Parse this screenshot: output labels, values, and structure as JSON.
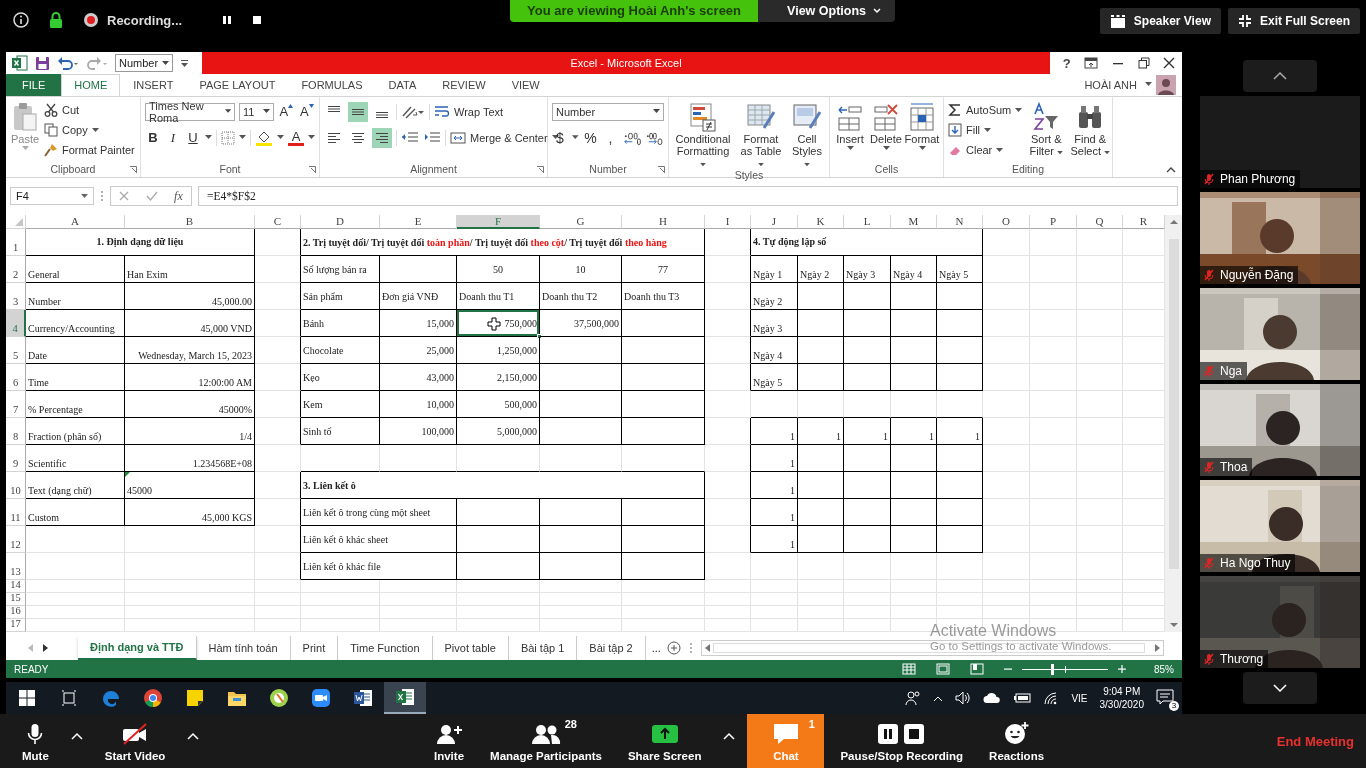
{
  "zoom_top": {
    "recording": "Recording...",
    "banner": "You are viewing Hoài Anh's screen",
    "view_options": "View Options",
    "speaker_view": "Speaker View",
    "exit_full_screen": "Exit Full Screen"
  },
  "excel": {
    "quick_format": "Number",
    "title": "Excel -  Microsoft Excel",
    "help": "?",
    "tabs": [
      {
        "label": "FILE",
        "kind": "file",
        "selected": false
      },
      {
        "label": "HOME",
        "kind": "tab",
        "selected": true
      },
      {
        "label": "INSERT",
        "kind": "tab",
        "selected": false
      },
      {
        "label": "PAGE LAYOUT",
        "kind": "tab",
        "selected": false
      },
      {
        "label": "FORMULAS",
        "kind": "tab",
        "selected": false
      },
      {
        "label": "DATA",
        "kind": "tab",
        "selected": false
      },
      {
        "label": "REVIEW",
        "kind": "tab",
        "selected": false
      },
      {
        "label": "VIEW",
        "kind": "tab",
        "selected": false
      }
    ],
    "user": "HOÀI ANH",
    "ribbon": {
      "clipboard": {
        "label": "Clipboard",
        "paste": "Paste",
        "cut": "Cut",
        "copy": "Copy",
        "format_painter": "Format Painter"
      },
      "font": {
        "label": "Font",
        "name": "Times New Roma",
        "size": "11",
        "grow": "A",
        "shrink": "A",
        "bold": "B",
        "italic": "I",
        "underline": "U",
        "font_color_letter": "A"
      },
      "alignment": {
        "label": "Alignment",
        "wrap": "Wrap Text",
        "merge": "Merge & Center",
        "vertical": [
          {
            "selected": false
          },
          {
            "selected": true
          },
          {
            "selected": false
          }
        ],
        "horizontal": [
          {
            "selected": false
          },
          {
            "selected": false
          },
          {
            "selected": true
          }
        ]
      },
      "number": {
        "label": "Number",
        "format": "Number",
        "currency": "$",
        "percent": "%",
        "comma": ","
      },
      "styles": {
        "label": "Styles",
        "items": [
          "Conditional Formatting",
          "Format as Table",
          "Cell Styles"
        ]
      },
      "cells": {
        "label": "Cells",
        "items": [
          "Insert",
          "Delete",
          "Format"
        ]
      },
      "editing": {
        "label": "Editing",
        "autosum": "AutoSum",
        "fill": "Fill",
        "clear": "Clear",
        "sort": "Sort & Filter",
        "find": "Find & Select"
      }
    },
    "formula_bar": {
      "name_box": "F4",
      "fx": "fx",
      "formula": "=E4*$F$2"
    },
    "columns": [
      {
        "label": "A",
        "selected": false
      },
      {
        "label": "B",
        "selected": false
      },
      {
        "label": "C",
        "selected": false
      },
      {
        "label": "D",
        "selected": false
      },
      {
        "label": "E",
        "selected": false
      },
      {
        "label": "F",
        "selected": true
      },
      {
        "label": "G",
        "selected": false
      },
      {
        "label": "H",
        "selected": false
      },
      {
        "label": "I",
        "selected": false
      },
      {
        "label": "J",
        "selected": false
      },
      {
        "label": "K",
        "selected": false
      },
      {
        "label": "L",
        "selected": false
      },
      {
        "label": "M",
        "selected": false
      },
      {
        "label": "N",
        "selected": false
      },
      {
        "label": "O",
        "selected": false
      },
      {
        "label": "P",
        "selected": false
      },
      {
        "label": "Q",
        "selected": false
      },
      {
        "label": "R",
        "selected": false
      }
    ],
    "rows": [
      {
        "label": "1",
        "selected": false,
        "cells": [
          {
            "text": "1. Định dạng dữ liệu",
            "kind": "title",
            "bordered": true
          },
          {
            "kind": "merged"
          },
          {
            "bordered": false
          },
          {
            "kind": "rich",
            "bordered": true,
            "segments": [
              {
                "text": "2. Trị tuyệt đối/ Trị tuyệt đối ",
                "highlight": false
              },
              {
                "text": "toàn phần",
                "highlight": true
              },
              {
                "text": "/ Trị tuyệt đối ",
                "highlight": false
              },
              {
                "text": "theo cột",
                "highlight": true
              },
              {
                "text": "/ Trị tuyệt đối ",
                "highlight": false
              },
              {
                "text": "theo hàng",
                "highlight": true
              }
            ]
          },
          {
            "kind": "merged"
          },
          {
            "kind": "merged"
          },
          {
            "kind": "merged"
          },
          {
            "kind": "merged"
          },
          {
            "bordered": false
          },
          {
            "text": "4. Tự động lập số",
            "kind": "heading",
            "bordered": true
          },
          {
            "kind": "merged"
          },
          {
            "kind": "merged"
          },
          {
            "kind": "merged"
          },
          {
            "kind": "merged"
          }
        ]
      },
      {
        "label": "2",
        "selected": false,
        "cells": [
          {
            "text": "General",
            "kind": "text",
            "bordered": true
          },
          {
            "text": "Han Exim",
            "kind": "text",
            "bordered": true
          },
          {
            "bordered": false
          },
          {
            "text": "Số lượng bán ra",
            "kind": "text",
            "bordered": true
          },
          {
            "bordered": true
          },
          {
            "text": "50",
            "kind": "centered",
            "bordered": true
          },
          {
            "text": "10",
            "kind": "centered",
            "bordered": true
          },
          {
            "text": "77",
            "kind": "centered",
            "bordered": true
          },
          {
            "bordered": false
          },
          {
            "text": "Ngày 1",
            "kind": "text",
            "bordered": true
          },
          {
            "text": "Ngày 2",
            "kind": "text",
            "bordered": true
          },
          {
            "text": "Ngày 3",
            "kind": "text",
            "bordered": true
          },
          {
            "text": "Ngày 4",
            "kind": "text",
            "bordered": true
          },
          {
            "text": "Ngày 5",
            "kind": "text",
            "bordered": true
          }
        ]
      },
      {
        "label": "3",
        "selected": false,
        "cells": [
          {
            "text": "Number",
            "kind": "text",
            "bordered": true
          },
          {
            "text": "45,000.00",
            "kind": "number",
            "bordered": true
          },
          {
            "bordered": false
          },
          {
            "text": "Sản phẩm",
            "kind": "text",
            "bordered": true
          },
          {
            "text": "Đơn giá VNĐ",
            "kind": "text",
            "bordered": true
          },
          {
            "text": "Doanh thu T1",
            "kind": "text",
            "bordered": true
          },
          {
            "text": "Doanh thu T2",
            "kind": "text",
            "bordered": true
          },
          {
            "text": "Doanh thu T3",
            "kind": "text",
            "bordered": true
          },
          {
            "bordered": false
          },
          {
            "text": "Ngày 2",
            "kind": "text",
            "bordered": true
          },
          {
            "bordered": true
          },
          {
            "bordered": true
          },
          {
            "bordered": true
          },
          {
            "bordered": true
          }
        ]
      },
      {
        "label": "4",
        "selected": true,
        "cells": [
          {
            "text": "Currency/Accounting",
            "kind": "text",
            "bordered": true
          },
          {
            "text": "45,000 VND",
            "kind": "number",
            "bordered": true
          },
          {
            "bordered": false
          },
          {
            "text": "Bánh",
            "kind": "text",
            "bordered": true
          },
          {
            "text": "15,000",
            "kind": "number",
            "bordered": true
          },
          {
            "text": "750,000",
            "kind": "number",
            "bordered": true
          },
          {
            "text": "37,500,000",
            "kind": "number",
            "bordered": true
          },
          {
            "bordered": true
          },
          {
            "bordered": false
          },
          {
            "text": "Ngày 3",
            "kind": "text",
            "bordered": true
          },
          {
            "bordered": true
          },
          {
            "bordered": true
          },
          {
            "bordered": true
          },
          {
            "bordered": true
          }
        ]
      },
      {
        "label": "5",
        "selected": false,
        "cells": [
          {
            "text": "Date",
            "kind": "text",
            "bordered": true
          },
          {
            "text": "Wednesday, March 15, 2023",
            "kind": "number",
            "bordered": true
          },
          {
            "bordered": false
          },
          {
            "text": "Chocolate",
            "kind": "text",
            "bordered": true
          },
          {
            "text": "25,000",
            "kind": "number",
            "bordered": true
          },
          {
            "text": "1,250,000",
            "kind": "number",
            "bordered": true
          },
          {
            "bordered": true
          },
          {
            "bordered": true
          },
          {
            "bordered": false
          },
          {
            "text": "Ngày 4",
            "kind": "text",
            "bordered": true
          },
          {
            "bordered": true
          },
          {
            "bordered": true
          },
          {
            "bordered": true
          },
          {
            "bordered": true
          }
        ]
      },
      {
        "label": "6",
        "selected": false,
        "cells": [
          {
            "text": "Time",
            "kind": "text",
            "bordered": true
          },
          {
            "text": "12:00:00 AM",
            "kind": "number",
            "bordered": true
          },
          {
            "bordered": false
          },
          {
            "text": "Kẹo",
            "kind": "text",
            "bordered": true
          },
          {
            "text": "43,000",
            "kind": "number",
            "bordered": true
          },
          {
            "text": "2,150,000",
            "kind": "number",
            "bordered": true
          },
          {
            "bordered": true
          },
          {
            "bordered": true
          },
          {
            "bordered": false
          },
          {
            "text": "Ngày 5",
            "kind": "text",
            "bordered": true
          },
          {
            "bordered": true
          },
          {
            "bordered": true
          },
          {
            "bordered": true
          },
          {
            "bordered": true
          }
        ]
      },
      {
        "label": "7",
        "selected": false,
        "cells": [
          {
            "text": "% Percentage",
            "kind": "text",
            "bordered": true
          },
          {
            "text": "45000%",
            "kind": "number",
            "bordered": true
          },
          {
            "bordered": false
          },
          {
            "text": "Kem",
            "kind": "text",
            "bordered": true
          },
          {
            "text": "10,000",
            "kind": "number",
            "bordered": true
          },
          {
            "text": "500,000",
            "kind": "number",
            "bordered": true
          },
          {
            "bordered": true
          },
          {
            "bordered": true
          }
        ]
      },
      {
        "label": "8",
        "selected": false,
        "cells": [
          {
            "text": "Fraction (phân số)",
            "kind": "text",
            "bordered": true
          },
          {
            "text": "1/4",
            "kind": "number",
            "bordered": true
          },
          {
            "bordered": false
          },
          {
            "text": "Sinh tố",
            "kind": "text",
            "bordered": true
          },
          {
            "text": "100,000",
            "kind": "number",
            "bordered": true
          },
          {
            "text": "5,000,000",
            "kind": "number",
            "bordered": true
          },
          {
            "bordered": true
          },
          {
            "bordered": true
          },
          {
            "bordered": false
          },
          {
            "text": "1",
            "kind": "number",
            "bordered": true
          },
          {
            "text": "1",
            "kind": "number",
            "bordered": true
          },
          {
            "text": "1",
            "kind": "number",
            "bordered": true
          },
          {
            "text": "1",
            "kind": "number",
            "bordered": true
          },
          {
            "text": "1",
            "kind": "number",
            "bordered": true
          }
        ]
      },
      {
        "label": "9",
        "selected": false,
        "cells": [
          {
            "text": "Scientific",
            "kind": "text",
            "bordered": true
          },
          {
            "text": "1.234568E+08",
            "kind": "number",
            "bordered": true
          },
          {
            "bordered": false
          },
          {
            "bordered": false
          },
          {
            "bordered": false
          },
          {
            "bordered": false
          },
          {
            "bordered": false
          },
          {
            "bordered": false
          },
          {
            "bordered": false
          },
          {
            "text": "1",
            "kind": "number",
            "bordered": true
          },
          {
            "bordered": true
          },
          {
            "bordered": true
          },
          {
            "bordered": true
          },
          {
            "bordered": true
          }
        ]
      },
      {
        "label": "10",
        "selected": false,
        "cells": [
          {
            "text": "Text (dạng chữ)",
            "kind": "text",
            "bordered": true
          },
          {
            "text": "45000",
            "kind": "text",
            "bordered": true,
            "flagged": true
          },
          {
            "bordered": false
          },
          {
            "text": "3. Liên kết ô",
            "kind": "heading",
            "bordered": true
          },
          {
            "kind": "merged"
          },
          {
            "kind": "merged"
          },
          {
            "kind": "merged"
          },
          {
            "kind": "merged"
          },
          {
            "bordered": false
          },
          {
            "text": "1",
            "kind": "number",
            "bordered": true
          },
          {
            "bordered": true
          },
          {
            "bordered": true
          },
          {
            "bordered": true
          },
          {
            "bordered": true
          }
        ]
      },
      {
        "label": "11",
        "selected": false,
        "cells": [
          {
            "text": "Custom",
            "kind": "text",
            "bordered": true
          },
          {
            "text": "45,000 KGS",
            "kind": "number",
            "bordered": true
          },
          {
            "bordered": false
          },
          {
            "text": "Liên kết ô trong cùng một sheet",
            "kind": "text",
            "bordered": true
          },
          {
            "kind": "merged"
          },
          {
            "bordered": true
          },
          {
            "bordered": true
          },
          {
            "bordered": true
          },
          {
            "bordered": false
          },
          {
            "text": "1",
            "kind": "number",
            "bordered": true
          },
          {
            "bordered": true
          },
          {
            "bordered": true
          },
          {
            "bordered": true
          },
          {
            "bordered": true
          }
        ]
      },
      {
        "label": "12",
        "selected": false,
        "cells": [
          {
            "bordered": false
          },
          {
            "bordered": false
          },
          {
            "bordered": false
          },
          {
            "text": "Liên kết ô khác sheet",
            "kind": "text",
            "bordered": true
          },
          {
            "kind": "merged"
          },
          {
            "bordered": true
          },
          {
            "bordered": true
          },
          {
            "bordered": true
          },
          {
            "bordered": false
          },
          {
            "text": "1",
            "kind": "number",
            "bordered": true
          },
          {
            "bordered": true
          },
          {
            "bordered": true
          },
          {
            "bordered": true
          },
          {
            "bordered": true
          }
        ]
      },
      {
        "label": "13",
        "selected": false,
        "cells": [
          {
            "bordered": false
          },
          {
            "bordered": false
          },
          {
            "bordered": false
          },
          {
            "text": "Liên kết ô khác file",
            "kind": "text",
            "bordered": true
          },
          {
            "kind": "merged"
          },
          {
            "bordered": true
          },
          {
            "bordered": true
          },
          {
            "bordered": true
          }
        ]
      },
      {
        "label": "14",
        "selected": false
      },
      {
        "label": "15",
        "selected": false
      },
      {
        "label": "16",
        "selected": false
      },
      {
        "label": "17",
        "selected": false
      }
    ],
    "sheet_tabs": [
      {
        "label": "Định dạng và TTĐ",
        "selected": true
      },
      {
        "label": "Hàm tính toán",
        "selected": false
      },
      {
        "label": "Print",
        "selected": false
      },
      {
        "label": "Time Function",
        "selected": false
      },
      {
        "label": "Pivot table",
        "selected": false
      },
      {
        "label": "Bài tập 1",
        "selected": false
      },
      {
        "label": "Bài tập 2",
        "selected": false
      }
    ],
    "more_tabs": "...",
    "status": "READY",
    "zoom": {
      "level": 0.35,
      "reading": "85%"
    }
  },
  "activation_notice": {
    "title": "Activate Windows",
    "detail": "Go to Settings to activate Windows."
  },
  "taskbar": {
    "apps": [
      {
        "kind": "start",
        "selected": false
      },
      {
        "kind": "task-view",
        "selected": false
      },
      {
        "kind": "edge",
        "selected": false
      },
      {
        "kind": "chrome",
        "selected": false
      },
      {
        "kind": "sticky",
        "selected": false
      },
      {
        "kind": "explorer",
        "selected": false
      },
      {
        "kind": "green-app",
        "selected": false
      },
      {
        "kind": "zoom",
        "selected": false
      },
      {
        "kind": "word",
        "selected": false
      },
      {
        "kind": "excel",
        "selected": true
      }
    ],
    "language": "VIE",
    "time": "9:04 PM",
    "date": "3/30/2020",
    "notifications": "3"
  },
  "participants": [
    {
      "name": "Phan Phương",
      "muted": true,
      "video": false
    },
    {
      "name": "Nguyễn Đặng",
      "muted": true,
      "video": true
    },
    {
      "name": "Nga",
      "muted": true,
      "video": true
    },
    {
      "name": "Thoa",
      "muted": true,
      "video": true
    },
    {
      "name": "Ha Ngo Thuy",
      "muted": true,
      "video": true
    },
    {
      "name": "Thương",
      "muted": true,
      "video": true
    }
  ],
  "toolbar": {
    "items": [
      {
        "kind": "mute",
        "label": "Mute"
      },
      {
        "kind": "caret"
      },
      {
        "kind": "video-off",
        "label": "Start Video"
      },
      {
        "kind": "caret"
      },
      {
        "kind": "invite",
        "label": "Invite"
      },
      {
        "kind": "participants",
        "label": "Manage Participants",
        "count": "28"
      },
      {
        "kind": "share",
        "label": "Share Screen"
      },
      {
        "kind": "caret"
      },
      {
        "kind": "chat",
        "label": "Chat",
        "count": "1"
      },
      {
        "kind": "recording",
        "label": "Pause/Stop Recording"
      },
      {
        "kind": "reactions",
        "label": "Reactions"
      }
    ],
    "end_meeting": "End Meeting"
  }
}
